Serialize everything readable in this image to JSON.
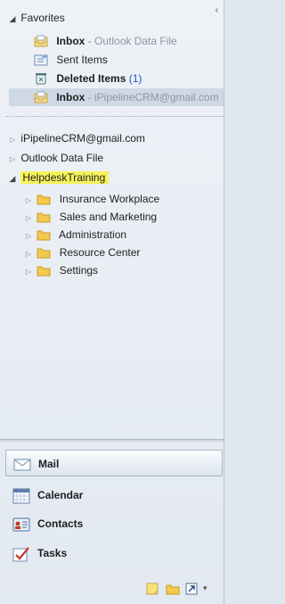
{
  "favorites": {
    "header": "Favorites",
    "items": [
      {
        "label": "Inbox",
        "suffix": " - Outlook Data File"
      },
      {
        "label": "Sent Items",
        "suffix": ""
      },
      {
        "label": "Deleted Items",
        "count": "(1)"
      },
      {
        "label": "Inbox",
        "suffix": " - iPipelineCRM@gmail.com"
      }
    ]
  },
  "accounts": [
    {
      "label": "iPipelineCRM@gmail.com"
    },
    {
      "label": "Outlook Data File"
    },
    {
      "label": "HelpdeskTraining"
    }
  ],
  "helpdesk_folders": [
    "Insurance Workplace",
    "Sales and Marketing",
    "Administration",
    "Resource Center",
    "Settings"
  ],
  "nav": {
    "mail": "Mail",
    "calendar": "Calendar",
    "contacts": "Contacts",
    "tasks": "Tasks"
  },
  "colors": {
    "highlight": "#f6f35a",
    "selected_row": "#cfd9e6",
    "count_blue": "#1f4fbf"
  }
}
